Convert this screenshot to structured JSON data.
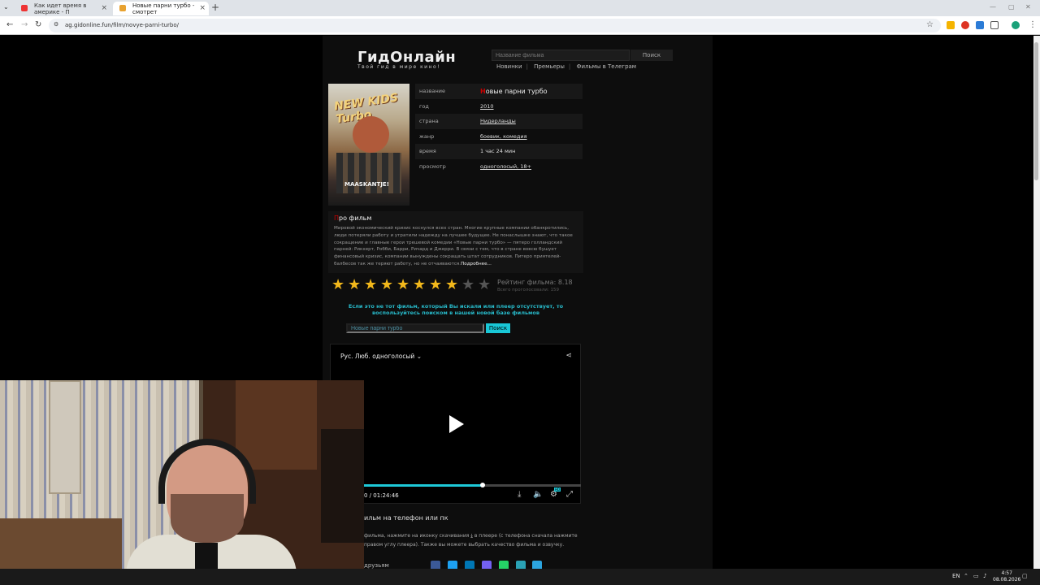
{
  "browser": {
    "tabs": [
      {
        "label": "Как идет время в америке - П"
      },
      {
        "label": "Новые парни турбо - смотрет"
      }
    ],
    "url": "ag.gidonline.fun/film/novye-parni-turbo/"
  },
  "site": {
    "logo": "ГидОнлайн",
    "tagline": "Твой гид в мире кино!",
    "search_placeholder": "Название фильма",
    "search_button": "Поиск",
    "nav": [
      "Новинки",
      "Премьеры",
      "Фильмы в Телеграм"
    ]
  },
  "poster": {
    "title_art": "NEW KIDS Turbo",
    "bottom_text": "MAASKANTJE!"
  },
  "film": {
    "rows": [
      {
        "key": "название",
        "first_letter": "Н",
        "value": "овые парни турбо"
      },
      {
        "key": "год",
        "value": "2010"
      },
      {
        "key": "страна",
        "value": "Нидерланды"
      },
      {
        "key": "жанр",
        "value": "боевик, комедия"
      },
      {
        "key": "время",
        "value": "1 час 24 мин"
      },
      {
        "key": "просмотр",
        "value": "одноголосый, 18+"
      }
    ]
  },
  "about": {
    "title_first": "П",
    "title_rest": "ро фильм",
    "text": "Мировой экономический кризис коснулся всех стран. Многие крупные компании обанкротились, люди потеряли работу и утратили надежду на лучшее будущее. Не понаслышке знают, что такое сокращение и главные герои трешевой комедии «Новые парни турбо» — пятеро голландский парней: Рикхерт, Робби, Барри, Ричард и Джерри. В связи с тем, что в стране вовсю бушует финансовый кризис, компании вынуждены сокращать штат сотрудников. Питеро приятелей-балбесов так же теряют работу, но не отчаиваются.",
    "more": "Подробнее..."
  },
  "rating": {
    "stars_filled": 8,
    "stars_total": 10,
    "label": "Рейтинг фильма: 8.18",
    "votes": "Всего проголосовали: 159"
  },
  "notice": "Если это не тот фильм, который Вы искали или плеер отсутствует, то воспользуйтесь поиском в нашей новой базе фильмов",
  "search2": {
    "value": "Новые парни турбо",
    "button": "Поиск"
  },
  "player": {
    "audio": "Рус. Люб. одноголосый",
    "time": "0 / 01:24:46",
    "progress": 0.55,
    "hd_badge": "HD"
  },
  "download": {
    "title": "ильм на телефон или пк",
    "text1": "фильма, нажмите на иконку скачивания",
    "text2": "в плеере (с телефона сначала нажмите",
    "text3": "правом углу плеера). Также вы можете выбрать качество фильма и озвучку.",
    "share_label": "друзьям"
  },
  "taskbar": {
    "lang": "EN",
    "time": "4:57",
    "date": "08.08.2026"
  },
  "colors": {
    "accent": "#1ec9d8",
    "star": "#f2b81b",
    "red_letter": "#cc0000"
  }
}
